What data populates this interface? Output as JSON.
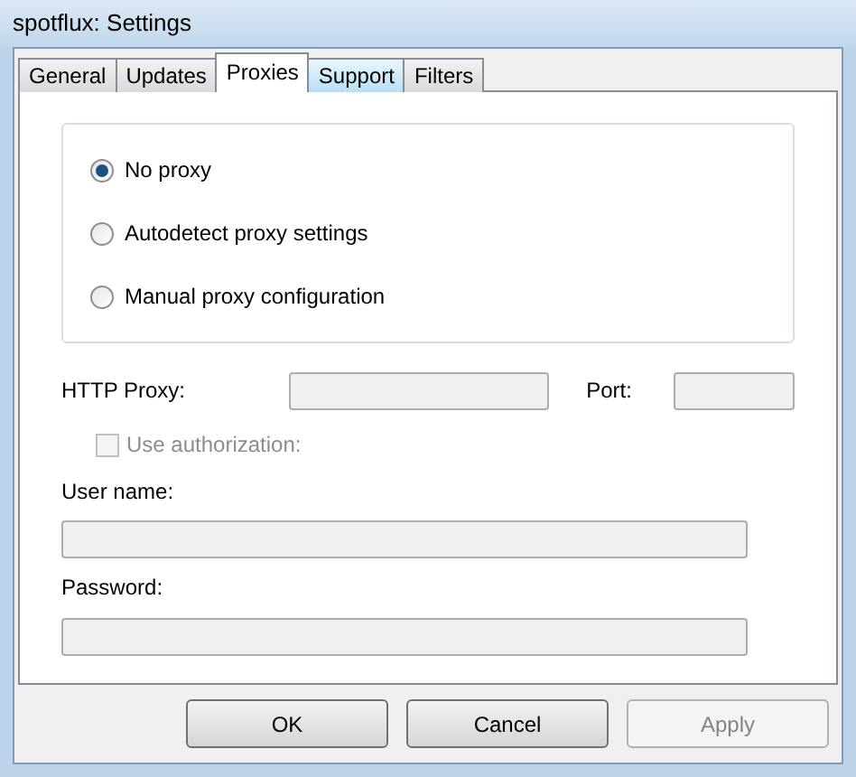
{
  "window": {
    "title": "spotflux: Settings"
  },
  "tabs": [
    {
      "label": "General",
      "selected": false,
      "hovered": false
    },
    {
      "label": "Updates",
      "selected": false,
      "hovered": false
    },
    {
      "label": "Proxies",
      "selected": true,
      "hovered": false
    },
    {
      "label": "Support",
      "selected": false,
      "hovered": true
    },
    {
      "label": "Filters",
      "selected": false,
      "hovered": false
    }
  ],
  "proxy_modes": [
    {
      "label": "No proxy",
      "selected": true
    },
    {
      "label": "Autodetect proxy settings",
      "selected": false
    },
    {
      "label": "Manual proxy configuration",
      "selected": false
    }
  ],
  "http_proxy": {
    "label": "HTTP Proxy:",
    "disabled": true
  },
  "port": {
    "label": "Port:",
    "disabled": true
  },
  "use_authorization": {
    "label": "Use authorization:",
    "checked": false,
    "disabled": true
  },
  "user_name": {
    "label": "User name:",
    "disabled": true
  },
  "password": {
    "label": "Password:",
    "disabled": true
  },
  "buttons": [
    {
      "label": "OK",
      "disabled": false
    },
    {
      "label": "Cancel",
      "disabled": false
    },
    {
      "label": "Apply",
      "disabled": true
    }
  ]
}
